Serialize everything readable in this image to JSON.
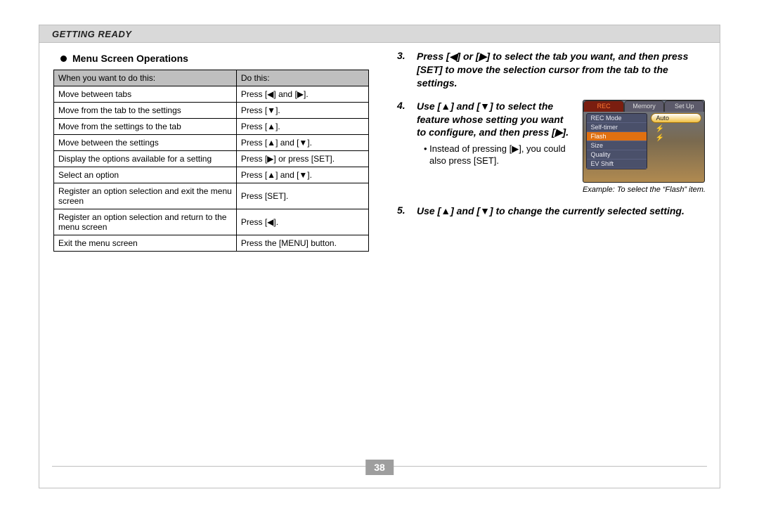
{
  "header": "GETTING READY",
  "subheader": "Menu Screen Operations",
  "table": {
    "headers": [
      "When you want to do this:",
      "Do this:"
    ],
    "rows": [
      [
        "Move between tabs",
        "Press [◀] and [▶]."
      ],
      [
        "Move from the tab to the settings",
        "Press [▼]."
      ],
      [
        "Move from the settings to the tab",
        "Press [▲]."
      ],
      [
        "Move between the settings",
        "Press [▲] and [▼]."
      ],
      [
        "Display the options available for a setting",
        "Press [▶] or press [SET]."
      ],
      [
        "Select an option",
        "Press [▲] and [▼]."
      ],
      [
        "Register an option selection and exit the menu screen",
        "Press [SET]."
      ],
      [
        "Register an option selection and return to the menu screen",
        "Press [◀]."
      ],
      [
        "Exit the menu screen",
        "Press the [MENU] button."
      ]
    ]
  },
  "steps": {
    "s3": {
      "num": "3.",
      "text": "Press [◀] or [▶] to select the tab you want, and then press [SET] to move the selection cursor from the tab to the settings."
    },
    "s4": {
      "num": "4.",
      "text": "Use [▲] and [▼] to select the feature whose setting you want to configure, and then press [▶].",
      "note": "• Instead of pressing [▶], you could also press [SET]."
    },
    "s5": {
      "num": "5.",
      "text": "Use [▲] and [▼] to change the currently selected setting."
    }
  },
  "cam": {
    "tabs": [
      "REC",
      "Memory",
      "Set Up"
    ],
    "menu": [
      "REC Mode",
      "Self-timer",
      "Flash",
      "Size",
      "Quality",
      "EV Shift"
    ],
    "option": "Auto",
    "caption": "Example: To select the “Flash” item."
  },
  "page_number": "38"
}
